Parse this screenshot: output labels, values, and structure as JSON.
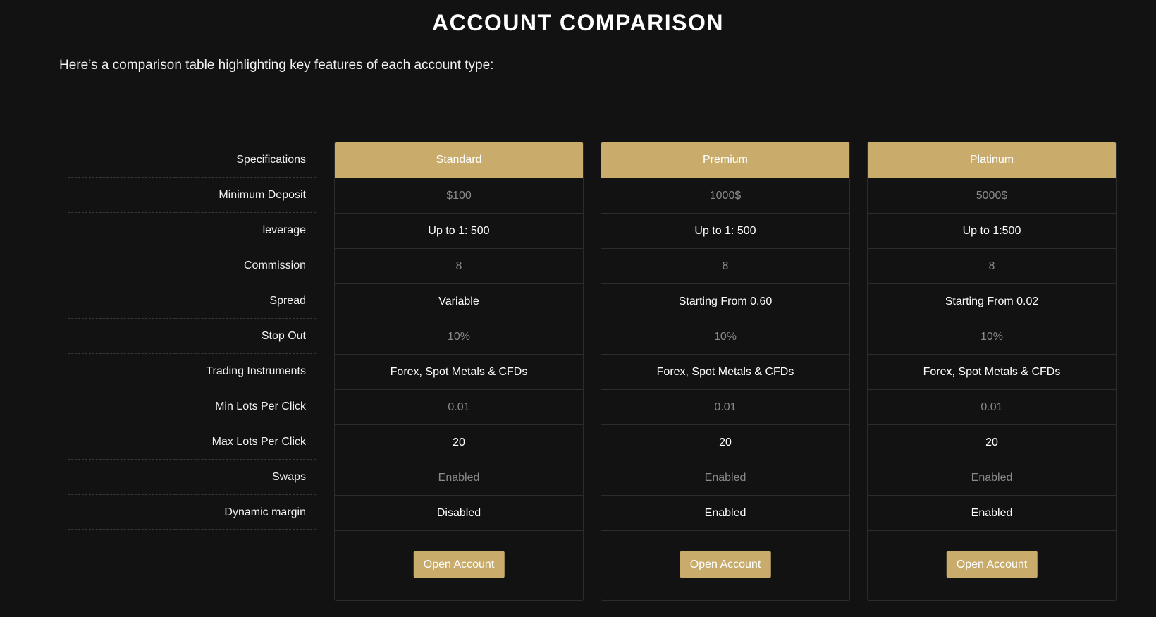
{
  "page": {
    "title": "ACCOUNT COMPARISON",
    "intro": "Here’s a comparison table highlighting key features of each account type:"
  },
  "labels": {
    "header": "Specifications",
    "rows": [
      "Minimum Deposit",
      "leverage",
      "Commission",
      "Spread",
      "Stop Out",
      "Trading Instruments",
      "Min Lots Per Click",
      "Max Lots Per Click",
      "Swaps",
      "Dynamic margin"
    ]
  },
  "plans": [
    {
      "name": "Standard",
      "values": [
        "$100",
        "Up to 1: 500",
        "8",
        "Variable",
        "10%",
        "Forex, Spot Metals & CFDs",
        "0.01",
        "20",
        "Enabled",
        "Disabled"
      ],
      "button": "Open Account"
    },
    {
      "name": "Premium",
      "values": [
        "1000$",
        "Up to 1: 500",
        "8",
        "Starting From 0.60",
        "10%",
        "Forex, Spot Metals & CFDs",
        "0.01",
        "20",
        "Enabled",
        "Enabled"
      ],
      "button": "Open Account"
    },
    {
      "name": "Platinum",
      "values": [
        "5000$",
        "Up to 1:500",
        "8",
        "Starting From 0.02",
        "10%",
        "Forex, Spot Metals & CFDs",
        "0.01",
        "20",
        "Enabled",
        "Enabled"
      ],
      "button": "Open Account"
    }
  ],
  "colors": {
    "background": "#121212",
    "accent": "#c9ac6b",
    "muted_text": "#8a8a8a",
    "border": "#2c2c2c"
  }
}
